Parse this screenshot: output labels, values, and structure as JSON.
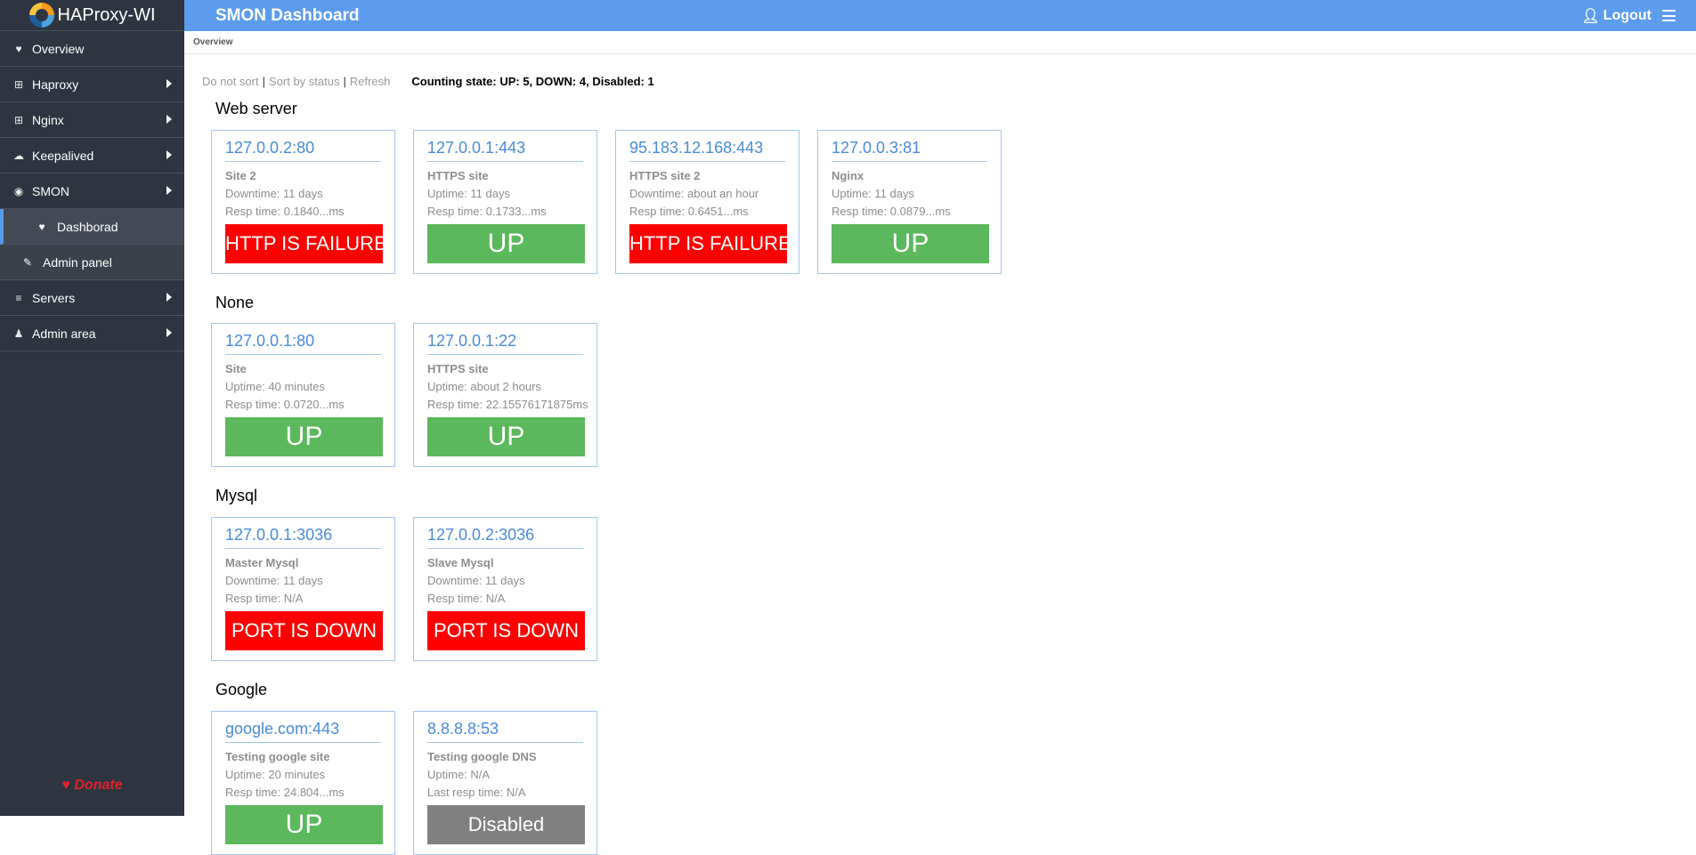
{
  "sidebar": {
    "logo": "HAProxy-WI",
    "items": [
      {
        "label": "Overview"
      },
      {
        "label": "Haproxy"
      },
      {
        "label": "Nginx"
      },
      {
        "label": "Keepalived"
      },
      {
        "label": "SMON"
      },
      {
        "label": "Dashborad"
      },
      {
        "label": "Admin panel"
      },
      {
        "label": "Servers"
      },
      {
        "label": "Admin area"
      }
    ],
    "donate": "Donate"
  },
  "header": {
    "title": "SMON Dashboard",
    "logout": "Logout",
    "breadcrumb": "Overview"
  },
  "sort": {
    "do_not_sort": "Do not sort",
    "sep": "|",
    "by_status": "Sort by status",
    "refresh": "Refresh",
    "counting": "Counting state: UP: 5, DOWN: 4, Disabled: 1"
  },
  "groups": [
    {
      "title": "Web server",
      "cards": [
        {
          "addr": "127.0.0.2:80",
          "name": "Site 2",
          "line1": "Downtime: 11 days",
          "line2": "Resp time: 0.1840...ms",
          "status": "HTTP IS FAILURE",
          "state": "fail"
        },
        {
          "addr": "127.0.0.1:443",
          "name": "HTTPS site",
          "line1": "Uptime: 11 days",
          "line2": "Resp time: 0.1733...ms",
          "status": "UP",
          "state": "up"
        },
        {
          "addr": "95.183.12.168:443",
          "name": "HTTPS site 2",
          "line1": "Downtime: about an hour",
          "line2": "Resp time: 0.6451...ms",
          "status": "HTTP IS FAILURE",
          "state": "fail"
        },
        {
          "addr": "127.0.0.3:81",
          "name": "Nginx",
          "line1": "Uptime: 11 days",
          "line2": "Resp time: 0.0879...ms",
          "status": "UP",
          "state": "up"
        }
      ]
    },
    {
      "title": "None",
      "cards": [
        {
          "addr": "127.0.0.1:80",
          "name": "Site",
          "line1": "Uptime: 40 minutes",
          "line2": "Resp time: 0.0720...ms",
          "status": "UP",
          "state": "up"
        },
        {
          "addr": "127.0.0.1:22",
          "name": "HTTPS site",
          "line1": "Uptime: about 2 hours",
          "line2": "Resp time: 22.15576171875ms",
          "status": "UP",
          "state": "up"
        }
      ]
    },
    {
      "title": "Mysql",
      "cards": [
        {
          "addr": "127.0.0.1:3036",
          "name": "Master Mysql",
          "line1": "Downtime: 11 days",
          "line2": "Resp time: N/A",
          "status": "PORT IS DOWN",
          "state": "fail"
        },
        {
          "addr": "127.0.0.2:3036",
          "name": "Slave Mysql",
          "line1": "Downtime: 11 days",
          "line2": "Resp time: N/A",
          "status": "PORT IS DOWN",
          "state": "fail"
        }
      ]
    },
    {
      "title": "Google",
      "cards": [
        {
          "addr": "google.com:443",
          "name": "Testing google site",
          "line1": "Uptime: 20 minutes",
          "line2": "Resp time: 24.804...ms",
          "status": "UP",
          "state": "up"
        },
        {
          "addr": "8.8.8.8:53",
          "name": "Testing google DNS",
          "line1": "Uptime: N/A",
          "line2": "Last resp time: N/A",
          "status": "Disabled",
          "state": "disabled"
        }
      ]
    }
  ],
  "colors": {
    "sidebar_bg": "#2e3540",
    "topbar_bg": "#5d9cec",
    "up": "#5cb85c",
    "fail": "#ff0000",
    "disabled": "#808080",
    "link": "#4a8ad9"
  }
}
